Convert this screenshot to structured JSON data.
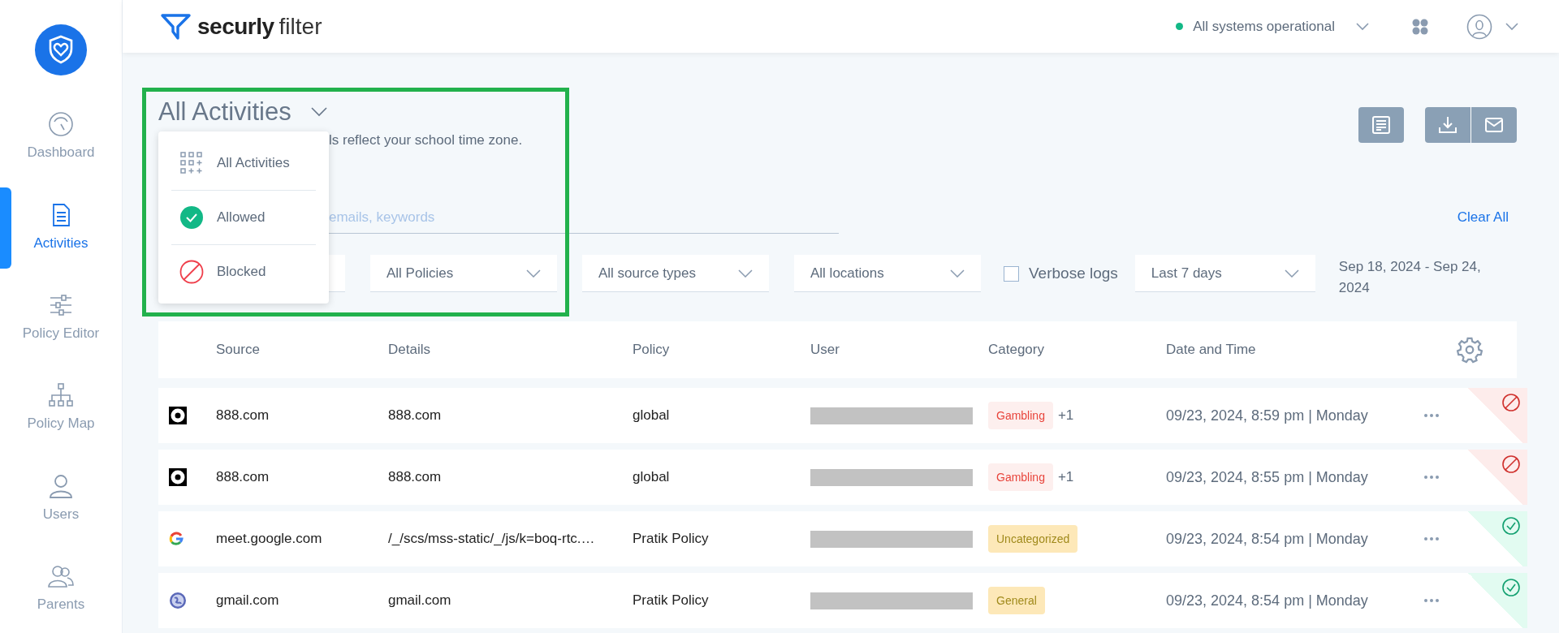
{
  "sidebar": {
    "items": [
      {
        "label": "Dashboard",
        "kind": "gauge",
        "selected": false
      },
      {
        "label": "Activities",
        "kind": "document",
        "selected": true
      },
      {
        "label": "Policy Editor",
        "kind": "sliders",
        "selected": false
      },
      {
        "label": "Policy Map",
        "kind": "hierarchy",
        "selected": false
      },
      {
        "label": "Users",
        "kind": "user",
        "selected": false
      },
      {
        "label": "Parents",
        "kind": "users",
        "selected": false
      }
    ]
  },
  "header": {
    "brand": "securly",
    "product": "filter",
    "status": {
      "label": "All systems operational",
      "color": "#12b886"
    }
  },
  "page": {
    "title": "All Activities",
    "subtitle": "ls reflect your school time zone.",
    "search": {
      "placeholder": "emails, keywords"
    },
    "clear_all": "Clear All",
    "filters": [
      {
        "label": "All Policies"
      },
      {
        "label": "All source types"
      },
      {
        "label": "All locations"
      }
    ],
    "verbose": {
      "label": "Verbose logs",
      "checked": false
    },
    "period": "Last 7 days",
    "date_range": "Sep 18, 2024 -  Sep 24, 2024"
  },
  "activity_menu": {
    "items": [
      {
        "kind": "all",
        "label": "All Activities"
      },
      {
        "kind": "allowed",
        "label": "Allowed"
      },
      {
        "kind": "blocked",
        "label": "Blocked"
      }
    ]
  },
  "table": {
    "columns": [
      "Source",
      "Details",
      "Policy",
      "User",
      "Category",
      "Date and Time"
    ],
    "rows": [
      {
        "kind": "dot",
        "source": "888.com",
        "details": "888.com",
        "policy": "global",
        "category": {
          "label": "Gambling",
          "kind": "danger"
        },
        "extra": "+1",
        "datetime": "09/23, 2024, 8:59 pm | Monday",
        "blocked": true
      },
      {
        "kind": "dot",
        "source": "888.com",
        "details": "888.com",
        "policy": "global",
        "category": {
          "label": "Gambling",
          "kind": "danger"
        },
        "extra": "+1",
        "datetime": "09/23, 2024, 8:55 pm | Monday",
        "blocked": true
      },
      {
        "kind": "google",
        "source": "meet.google.com",
        "details": "/_/scs/mss-static/_/js/k=boq-rtc.…",
        "policy": "Pratik Policy",
        "category": {
          "label": "Uncategorized",
          "kind": "warning"
        },
        "datetime": "09/23, 2024, 8:54 pm | Monday",
        "blocked": false
      },
      {
        "kind": "globe",
        "source": "gmail.com",
        "details": "gmail.com",
        "policy": "Pratik Policy",
        "category": {
          "label": "General",
          "kind": "warning"
        },
        "datetime": "09/23, 2024, 8:54 pm | Monday",
        "blocked": false
      }
    ]
  }
}
